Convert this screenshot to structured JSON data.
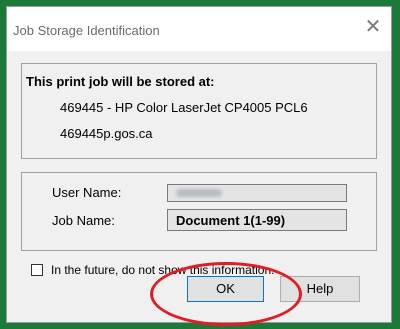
{
  "dialog": {
    "title": "Job Storage Identification",
    "close_symbol": "✕"
  },
  "storage": {
    "heading": "This print job will be stored at:",
    "printer": "469445 - HP Color LaserJet CP4005 PCL6",
    "host": "469445p.gos.ca"
  },
  "fields": {
    "user_name_label": "User Name:",
    "user_name_value": "",
    "job_name_label": "Job Name:",
    "job_name_value": "Document 1(1-99)"
  },
  "checkbox": {
    "label": "In the future, do not show this information.",
    "checked": false
  },
  "buttons": {
    "ok": "OK",
    "help": "Help"
  },
  "colors": {
    "frame": "#1b7a3a",
    "highlight": "#e31b23"
  }
}
